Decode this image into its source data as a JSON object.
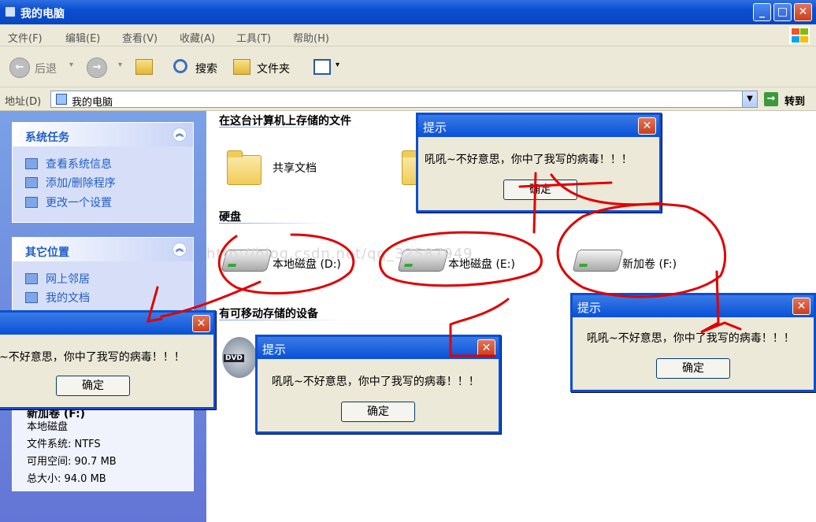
{
  "window": {
    "title": "我的电脑",
    "min": "_",
    "max": "□",
    "close": "✕"
  },
  "menu": [
    "文件(F)",
    "编辑(E)",
    "查看(V)",
    "收藏(A)",
    "工具(T)",
    "帮助(H)"
  ],
  "toolbar": {
    "back": "后退",
    "search": "搜索",
    "folders": "文件夹",
    "dropdown": "▾"
  },
  "address": {
    "label": "地址(D)",
    "value": "我的电脑",
    "go": "转到"
  },
  "left_pane": {
    "system_tasks": {
      "title": "系统任务",
      "items": [
        "查看系统信息",
        "添加/删除程序",
        "更改一个设置"
      ]
    },
    "other_places": {
      "title": "其它位置",
      "items": [
        "网上邻居",
        "我的文档"
      ]
    },
    "details": {
      "name": "新加卷 (F:)",
      "type": "本地磁盘",
      "fs": "文件系统: NTFS",
      "free": "可用空间: 90.7 MB",
      "total": "总大小: 94.0 MB"
    }
  },
  "main": {
    "stored_section": "在这台计算机上存储的文件",
    "shared_docs": "共享文档",
    "hdd_section": "硬盘",
    "drives": [
      "本地磁盘 (D:)",
      "本地磁盘 (E:)",
      "新加卷 (F:)"
    ],
    "removable_section": "有可移动存储的设备",
    "dvd_label": "DVD"
  },
  "watermark": "http://blog.csdn.net/qq_32587949",
  "dialogs": [
    {
      "title": "提示",
      "message": "吼吼~不好意思，你中了我写的病毒！！！",
      "button": "确定"
    },
    {
      "title": "提示",
      "message": "吼吼~不好意思，你中了我写的病毒！！！",
      "button": "确定"
    },
    {
      "title": "提示",
      "message": "吼吼~不好意思，你中了我写的病毒！！！",
      "button": "确定"
    },
    {
      "title": "提示",
      "message": "吼吼~不好意思，你中了我写的病毒！！！",
      "button": "确定"
    }
  ],
  "colors": {
    "xp_blue": "#0a4fd0",
    "task_blue": "#215dc6",
    "annotation_red": "#e00000"
  }
}
